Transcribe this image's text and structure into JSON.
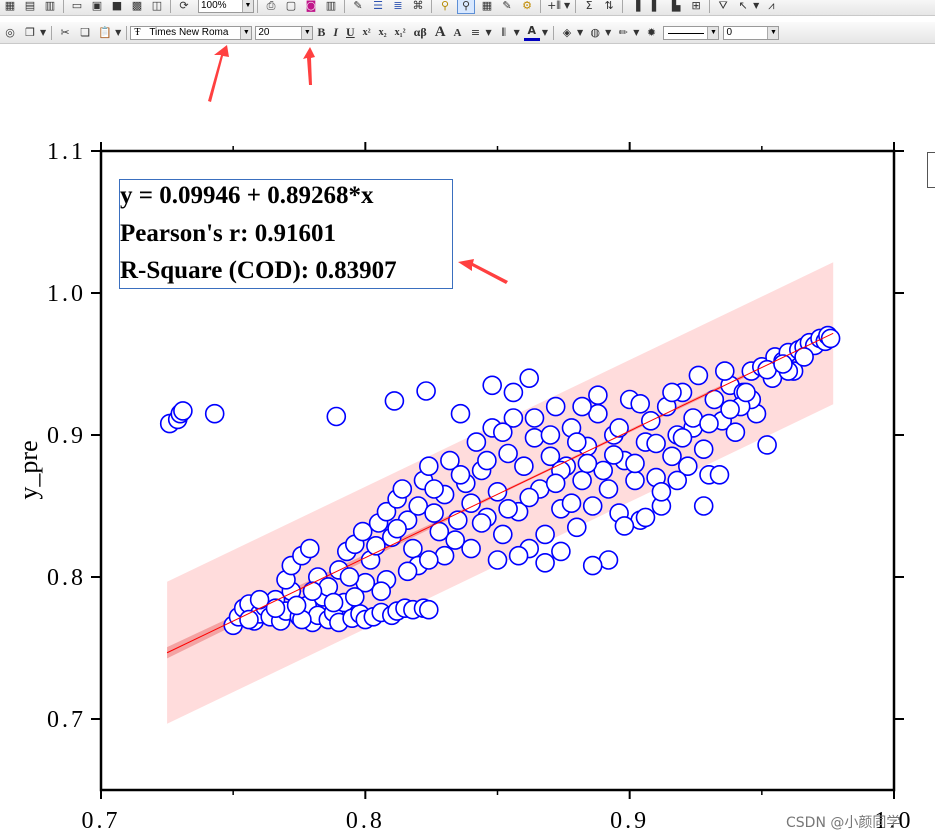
{
  "toolbar": {
    "zoom": "100%",
    "font_name": "Times New Roma",
    "font_size": "20",
    "bold_label": "B",
    "italic_label": "I",
    "underline_label": "U",
    "superscript_label": "x²",
    "subscript_label": "x₂",
    "super_sub_label": "x₁²",
    "greek_label": "αβ",
    "increase_font_label": "A",
    "decrease_font_label": "A",
    "line_width": "0",
    "row1_icons": [
      "new-book-icon",
      "new-graph-icon",
      "new-layout-icon",
      "open-icon",
      "open-template-icon",
      "save-icon",
      "save-template-icon",
      "import-icon",
      "recalculate-icon",
      "print-icon",
      "copy-page-icon",
      "palette-icon",
      "grid-icon",
      "code-builder-icon",
      "results-log-icon",
      "command-window-icon",
      "project-explorer-icon",
      "zoom-in-icon",
      "zoom-out-icon",
      "worksheet-icon",
      "notes-icon",
      "settings-icon",
      "add-column-icon",
      "statistics-icon",
      "sort-icon",
      "column-chart-icon",
      "bar-chart-icon",
      "histogram-icon",
      "box-chart-icon",
      "filter-icon",
      "arrow-tool-icon",
      "peak-icon"
    ],
    "row2_icons": [
      "refresh-icon",
      "duplicate-icon",
      "cut-icon",
      "copy-icon",
      "paste-icon"
    ]
  },
  "chart_data": {
    "type": "scatter",
    "title": "",
    "xlabel": "",
    "ylabel": "y_pre",
    "xlim": [
      0.7,
      1.0
    ],
    "ylim": [
      0.65,
      1.1
    ],
    "x_ticks": [
      "0.7",
      "0.8",
      "0.9",
      "1.0"
    ],
    "y_ticks": [
      "0.7",
      "0.8",
      "0.9",
      "1.0",
      "1.1"
    ],
    "fit": {
      "intercept": 0.09946,
      "slope": 0.89268,
      "x_range": [
        0.725,
        0.977
      ]
    },
    "prediction_band_halfwidth": 0.05,
    "confidence_band_halfwidth_at_start": 0.004,
    "colors": {
      "points": "#0000ff",
      "fit_line": "#ff0000",
      "prediction_band": "#ffdcdc",
      "confidence_band": "#f08a8a"
    },
    "annotations": [
      "y = 0.09946 + 0.89268*x",
      "Pearson's r: 0.91601",
      "R-Square (COD): 0.83907"
    ],
    "series": [
      {
        "marker": "open-circle",
        "points": [
          [
            0.726,
            0.908
          ],
          [
            0.729,
            0.911
          ],
          [
            0.73,
            0.915
          ],
          [
            0.731,
            0.917
          ],
          [
            0.743,
            0.915
          ],
          [
            0.789,
            0.913
          ],
          [
            0.811,
            0.924
          ],
          [
            0.823,
            0.931
          ],
          [
            0.75,
            0.766
          ],
          [
            0.752,
            0.772
          ],
          [
            0.754,
            0.778
          ],
          [
            0.756,
            0.781
          ],
          [
            0.758,
            0.769
          ],
          [
            0.76,
            0.774
          ],
          [
            0.762,
            0.779
          ],
          [
            0.764,
            0.772
          ],
          [
            0.766,
            0.784
          ],
          [
            0.768,
            0.769
          ],
          [
            0.77,
            0.776
          ],
          [
            0.772,
            0.79
          ],
          [
            0.775,
            0.772
          ],
          [
            0.778,
            0.78
          ],
          [
            0.78,
            0.768
          ],
          [
            0.782,
            0.773
          ],
          [
            0.784,
            0.786
          ],
          [
            0.786,
            0.77
          ],
          [
            0.788,
            0.775
          ],
          [
            0.79,
            0.768
          ],
          [
            0.792,
            0.782
          ],
          [
            0.795,
            0.771
          ],
          [
            0.798,
            0.774
          ],
          [
            0.8,
            0.77
          ],
          [
            0.803,
            0.772
          ],
          [
            0.806,
            0.775
          ],
          [
            0.81,
            0.773
          ],
          [
            0.812,
            0.776
          ],
          [
            0.815,
            0.778
          ],
          [
            0.818,
            0.777
          ],
          [
            0.822,
            0.778
          ],
          [
            0.824,
            0.777
          ],
          [
            0.77,
            0.798
          ],
          [
            0.772,
            0.808
          ],
          [
            0.776,
            0.815
          ],
          [
            0.779,
            0.82
          ],
          [
            0.782,
            0.8
          ],
          [
            0.786,
            0.793
          ],
          [
            0.79,
            0.805
          ],
          [
            0.793,
            0.818
          ],
          [
            0.796,
            0.823
          ],
          [
            0.799,
            0.832
          ],
          [
            0.802,
            0.812
          ],
          [
            0.805,
            0.838
          ],
          [
            0.808,
            0.846
          ],
          [
            0.81,
            0.828
          ],
          [
            0.812,
            0.855
          ],
          [
            0.814,
            0.862
          ],
          [
            0.816,
            0.84
          ],
          [
            0.818,
            0.82
          ],
          [
            0.82,
            0.85
          ],
          [
            0.822,
            0.868
          ],
          [
            0.824,
            0.878
          ],
          [
            0.826,
            0.845
          ],
          [
            0.828,
            0.832
          ],
          [
            0.83,
            0.858
          ],
          [
            0.832,
            0.882
          ],
          [
            0.835,
            0.84
          ],
          [
            0.838,
            0.866
          ],
          [
            0.84,
            0.852
          ],
          [
            0.842,
            0.895
          ],
          [
            0.844,
            0.875
          ],
          [
            0.846,
            0.842
          ],
          [
            0.848,
            0.905
          ],
          [
            0.85,
            0.86
          ],
          [
            0.852,
            0.83
          ],
          [
            0.854,
            0.887
          ],
          [
            0.856,
            0.912
          ],
          [
            0.858,
            0.846
          ],
          [
            0.86,
            0.878
          ],
          [
            0.862,
            0.82
          ],
          [
            0.864,
            0.898
          ],
          [
            0.866,
            0.862
          ],
          [
            0.868,
            0.83
          ],
          [
            0.87,
            0.885
          ],
          [
            0.872,
            0.92
          ],
          [
            0.874,
            0.848
          ],
          [
            0.876,
            0.878
          ],
          [
            0.878,
            0.905
          ],
          [
            0.88,
            0.835
          ],
          [
            0.882,
            0.868
          ],
          [
            0.884,
            0.892
          ],
          [
            0.886,
            0.85
          ],
          [
            0.888,
            0.915
          ],
          [
            0.89,
            0.875
          ],
          [
            0.892,
            0.862
          ],
          [
            0.894,
            0.9
          ],
          [
            0.896,
            0.845
          ],
          [
            0.898,
            0.882
          ],
          [
            0.9,
            0.925
          ],
          [
            0.902,
            0.868
          ],
          [
            0.904,
            0.84
          ],
          [
            0.906,
            0.895
          ],
          [
            0.908,
            0.91
          ],
          [
            0.91,
            0.87
          ],
          [
            0.912,
            0.85
          ],
          [
            0.914,
            0.92
          ],
          [
            0.916,
            0.885
          ],
          [
            0.918,
            0.9
          ],
          [
            0.92,
            0.93
          ],
          [
            0.922,
            0.878
          ],
          [
            0.924,
            0.905
          ],
          [
            0.926,
            0.942
          ],
          [
            0.928,
            0.89
          ],
          [
            0.93,
            0.872
          ],
          [
            0.932,
            0.925
          ],
          [
            0.935,
            0.91
          ],
          [
            0.938,
            0.935
          ],
          [
            0.94,
            0.902
          ],
          [
            0.943,
            0.93
          ],
          [
            0.946,
            0.945
          ],
          [
            0.948,
            0.915
          ],
          [
            0.95,
            0.948
          ],
          [
            0.952,
            0.893
          ],
          [
            0.955,
            0.955
          ],
          [
            0.958,
            0.952
          ],
          [
            0.96,
            0.958
          ],
          [
            0.962,
            0.945
          ],
          [
            0.964,
            0.96
          ],
          [
            0.966,
            0.962
          ],
          [
            0.968,
            0.965
          ],
          [
            0.97,
            0.963
          ],
          [
            0.972,
            0.968
          ],
          [
            0.974,
            0.966
          ],
          [
            0.975,
            0.97
          ],
          [
            0.976,
            0.968
          ],
          [
            0.856,
            0.93
          ],
          [
            0.862,
            0.94
          ],
          [
            0.848,
            0.935
          ],
          [
            0.836,
            0.915
          ],
          [
            0.874,
            0.875
          ],
          [
            0.88,
            0.895
          ],
          [
            0.892,
            0.812
          ],
          [
            0.898,
            0.836
          ],
          [
            0.886,
            0.808
          ],
          [
            0.906,
            0.842
          ],
          [
            0.912,
            0.86
          ],
          [
            0.918,
            0.868
          ],
          [
            0.928,
            0.85
          ],
          [
            0.934,
            0.872
          ],
          [
            0.946,
            0.925
          ],
          [
            0.85,
            0.812
          ],
          [
            0.858,
            0.815
          ],
          [
            0.868,
            0.81
          ],
          [
            0.874,
            0.818
          ],
          [
            0.84,
            0.82
          ],
          [
            0.83,
            0.815
          ],
          [
            0.82,
            0.808
          ],
          [
            0.808,
            0.798
          ],
          [
            0.8,
            0.796
          ],
          [
            0.794,
            0.8
          ],
          [
            0.804,
            0.822
          ],
          [
            0.812,
            0.834
          ],
          [
            0.826,
            0.862
          ],
          [
            0.836,
            0.872
          ],
          [
            0.846,
            0.882
          ],
          [
            0.852,
            0.902
          ],
          [
            0.864,
            0.912
          ],
          [
            0.87,
            0.9
          ],
          [
            0.882,
            0.92
          ],
          [
            0.888,
            0.928
          ],
          [
            0.896,
            0.905
          ],
          [
            0.904,
            0.922
          ],
          [
            0.916,
            0.93
          ],
          [
            0.924,
            0.912
          ],
          [
            0.936,
            0.945
          ],
          [
            0.942,
            0.92
          ],
          [
            0.954,
            0.94
          ],
          [
            0.96,
            0.945
          ],
          [
            0.966,
            0.955
          ],
          [
            0.78,
            0.79
          ],
          [
            0.776,
            0.77
          ],
          [
            0.76,
            0.784
          ],
          [
            0.756,
            0.77
          ],
          [
            0.766,
            0.778
          ],
          [
            0.774,
            0.78
          ],
          [
            0.788,
            0.782
          ],
          [
            0.796,
            0.786
          ],
          [
            0.806,
            0.79
          ],
          [
            0.816,
            0.804
          ],
          [
            0.824,
            0.812
          ],
          [
            0.834,
            0.826
          ],
          [
            0.844,
            0.838
          ],
          [
            0.854,
            0.848
          ],
          [
            0.862,
            0.856
          ],
          [
            0.872,
            0.866
          ],
          [
            0.878,
            0.852
          ],
          [
            0.884,
            0.88
          ],
          [
            0.894,
            0.886
          ],
          [
            0.902,
            0.88
          ],
          [
            0.91,
            0.894
          ],
          [
            0.92,
            0.898
          ],
          [
            0.93,
            0.908
          ],
          [
            0.938,
            0.918
          ],
          [
            0.944,
            0.93
          ],
          [
            0.952,
            0.946
          ],
          [
            0.958,
            0.95
          ]
        ]
      }
    ]
  },
  "watermark": "CSDN @小颜同学"
}
